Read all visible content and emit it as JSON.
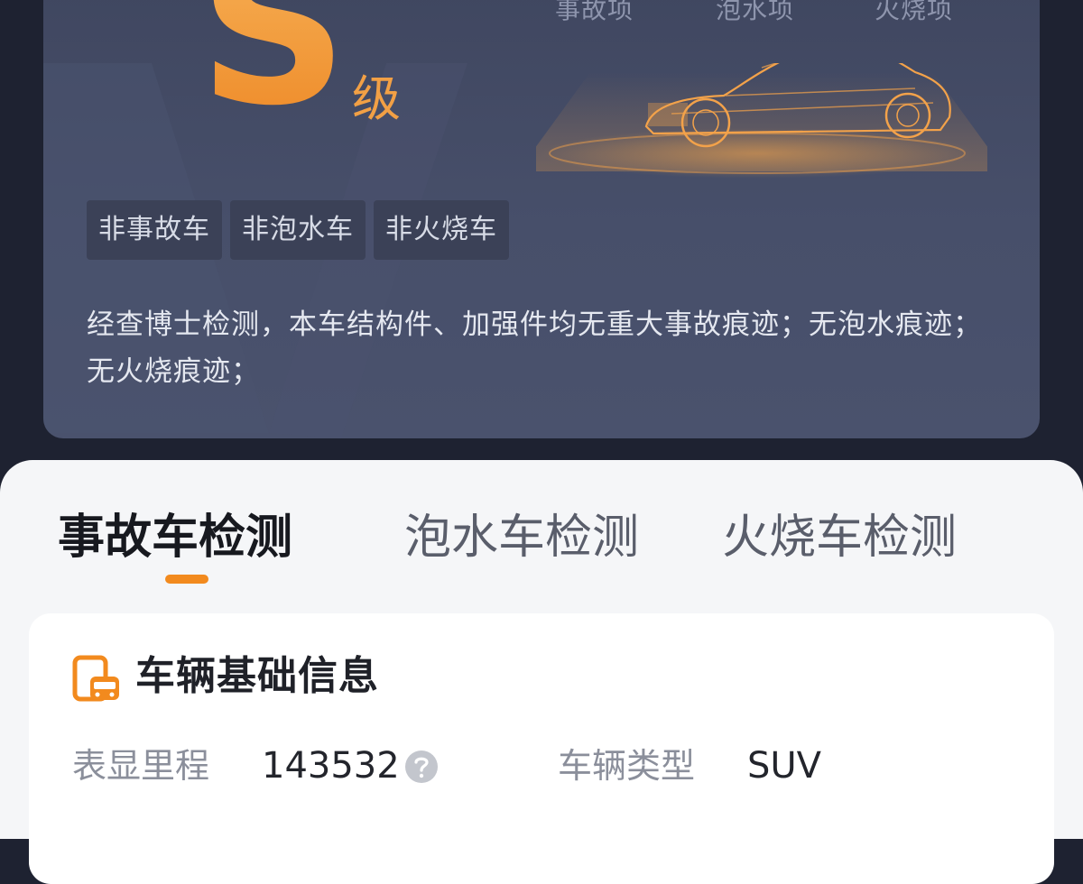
{
  "report": {
    "columns": [
      "事故项",
      "泡水项",
      "火烧项"
    ],
    "grade": "S",
    "grade_unit": "级",
    "tags": [
      "非事故车",
      "非泡水车",
      "非火烧车"
    ],
    "summary": "经查博士检测，本车结构件、加强件均无重大事故痕迹；无泡水痕迹；无火烧痕迹；"
  },
  "tabs": [
    {
      "label": "事故车检测",
      "active": true
    },
    {
      "label": "泡水车检测",
      "active": false
    },
    {
      "label": "火烧车检测",
      "active": false
    }
  ],
  "basic_info": {
    "title": "车辆基础信息",
    "icon": "car-document-icon",
    "mileage_label": "表显里程",
    "mileage_value": "143532",
    "vehicle_type_label": "车辆类型",
    "vehicle_type_value": "SUV"
  },
  "colors": {
    "accent": "#F28A1E",
    "grade": "#F29B3A",
    "dark_card": "#474F6A",
    "page_bg": "#1E2231"
  }
}
